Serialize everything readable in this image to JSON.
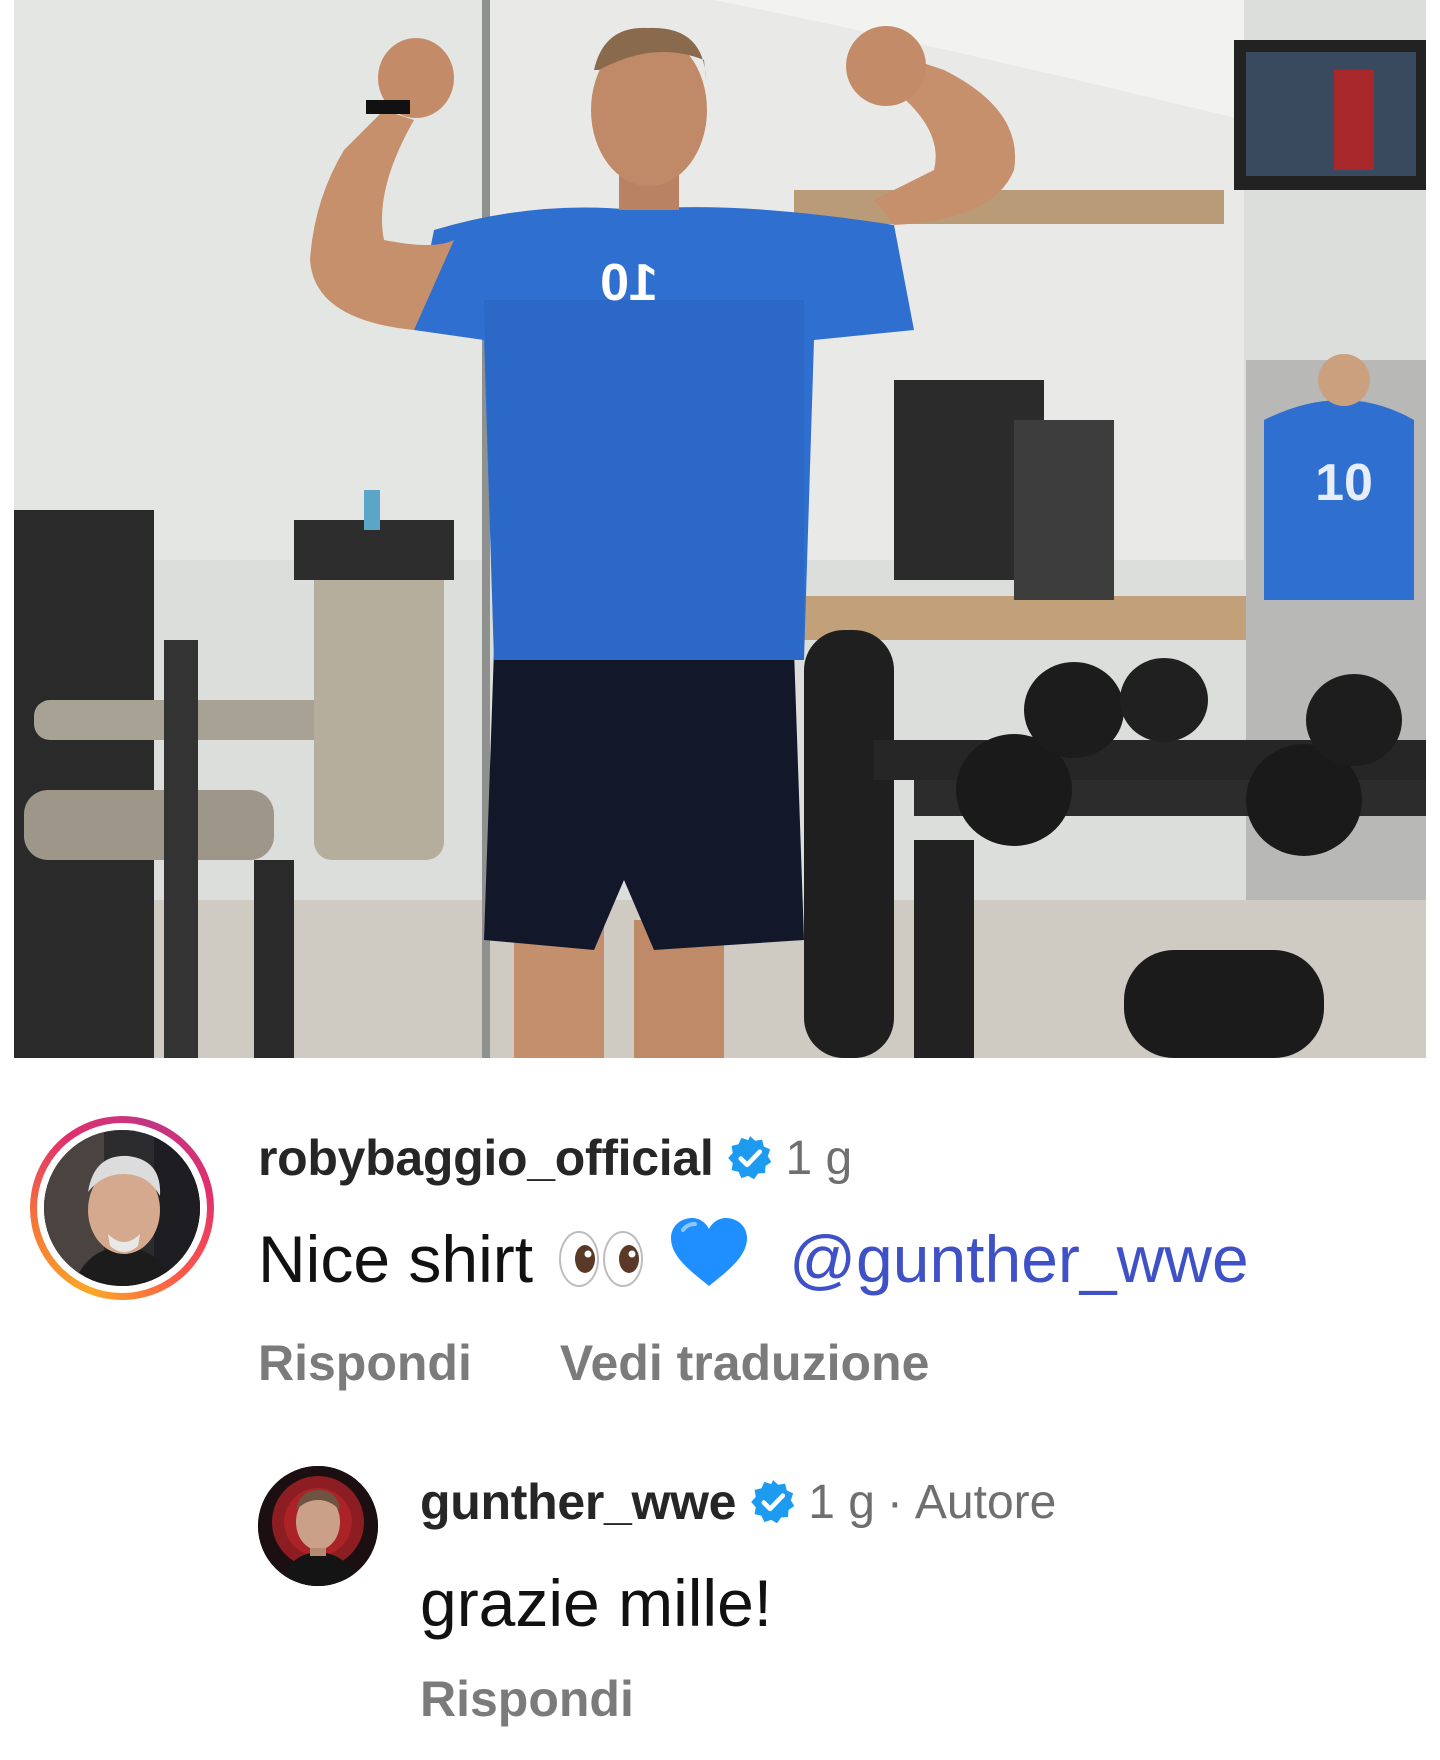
{
  "post": {
    "image_alt": "Photo of a man flexing in a gym mirror wearing a blue number 10 jersey"
  },
  "comments": [
    {
      "username": "robybaggio_official",
      "verified": true,
      "time": "1 g",
      "text": "Nice shirt",
      "emojis": [
        "eyes",
        "blue-heart"
      ],
      "mention": "@gunther_wwe",
      "actions": {
        "reply": "Rispondi",
        "translate": "Vedi traduzione"
      }
    },
    {
      "username": "gunther_wwe",
      "verified": true,
      "time": "1 g",
      "separator": "·",
      "author_badge": "Autore",
      "text": "grazie mille!",
      "actions": {
        "reply": "Rispondi"
      }
    }
  ],
  "colors": {
    "verified_blue": "#1d9bf0",
    "mention": "#3f51c7",
    "muted": "#7b7b7b",
    "jersey": "#2f6fcf"
  }
}
